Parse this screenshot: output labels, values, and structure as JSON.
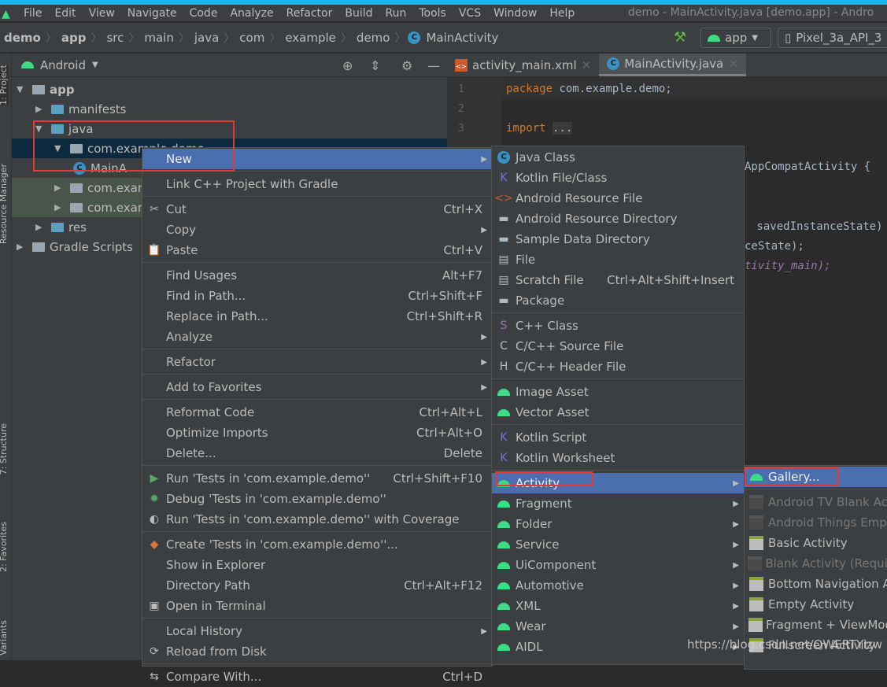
{
  "menubar": {
    "items": [
      "File",
      "Edit",
      "View",
      "Navigate",
      "Code",
      "Analyze",
      "Refactor",
      "Build",
      "Run",
      "Tools",
      "VCS",
      "Window",
      "Help"
    ],
    "window_title": "demo - MainActivity.java [demo.app] - Andro"
  },
  "breadcrumb": [
    "demo",
    "app",
    "src",
    "main",
    "java",
    "com",
    "example",
    "demo",
    "MainActivity"
  ],
  "run_config": "app",
  "device": "Pixel_3a_API_3",
  "side_tabs": [
    "1: Project",
    "Resource Manager",
    "7: Structure",
    "2: Favorites",
    "Variants"
  ],
  "project": {
    "view": "Android",
    "tree": [
      {
        "label": "app",
        "depth": 0,
        "open": true,
        "bold": true
      },
      {
        "label": "manifests",
        "depth": 1,
        "open": false
      },
      {
        "label": "java",
        "depth": 1,
        "open": true
      },
      {
        "label": "com.example.demo",
        "depth": 2,
        "open": true,
        "selected": true
      },
      {
        "label": "MainA",
        "depth": 3,
        "file": true
      },
      {
        "label": "com.exam",
        "depth": 2,
        "open": false,
        "test": true
      },
      {
        "label": "com.exam",
        "depth": 2,
        "open": false,
        "test": true
      },
      {
        "label": "res",
        "depth": 1,
        "open": false
      },
      {
        "label": "Gradle Scripts",
        "depth": 0,
        "open": false
      }
    ]
  },
  "editor": {
    "tabs": [
      "activity_main.xml",
      "MainActivity.java"
    ],
    "active_tab": 1,
    "line_numbers": [
      "1",
      "2",
      "3"
    ],
    "code": {
      "package_kw": "package",
      "package_name": " com.example.demo;",
      "import_kw": "import",
      "import_fold": "...",
      "l1": "AppCompatActivity {",
      "l2": " savedInstanceState)",
      "l3": "ceState);",
      "l4": "tivity_main);"
    }
  },
  "context_menu": [
    {
      "label": "New",
      "sel": true,
      "sub": true
    },
    "-",
    {
      "label": "Link C++ Project with Gradle"
    },
    "-",
    {
      "label": "Cut",
      "shortcut": "Ctrl+X",
      "icon": "scissors"
    },
    {
      "label": "Copy",
      "sub": true
    },
    {
      "label": "Paste",
      "shortcut": "Ctrl+V",
      "icon": "clipboard"
    },
    "-",
    {
      "label": "Find Usages",
      "shortcut": "Alt+F7"
    },
    {
      "label": "Find in Path...",
      "shortcut": "Ctrl+Shift+F"
    },
    {
      "label": "Replace in Path...",
      "shortcut": "Ctrl+Shift+R"
    },
    {
      "label": "Analyze",
      "sub": true
    },
    "-",
    {
      "label": "Refactor",
      "sub": true
    },
    "-",
    {
      "label": "Add to Favorites",
      "sub": true
    },
    "-",
    {
      "label": "Reformat Code",
      "shortcut": "Ctrl+Alt+L"
    },
    {
      "label": "Optimize Imports",
      "shortcut": "Ctrl+Alt+O"
    },
    {
      "label": "Delete...",
      "shortcut": "Delete"
    },
    "-",
    {
      "label": "Run 'Tests in 'com.example.demo''",
      "shortcut": "Ctrl+Shift+F10",
      "icon": "run"
    },
    {
      "label": "Debug 'Tests in 'com.example.demo''",
      "icon": "debug"
    },
    {
      "label": "Run 'Tests in 'com.example.demo'' with Coverage",
      "icon": "coverage"
    },
    "-",
    {
      "label": "Create 'Tests in 'com.example.demo''...",
      "icon": "create-test"
    },
    {
      "label": "Show in Explorer"
    },
    {
      "label": "Directory Path",
      "shortcut": "Ctrl+Alt+F12"
    },
    {
      "label": "Open in Terminal",
      "icon": "terminal"
    },
    "-",
    {
      "label": "Local History",
      "sub": true
    },
    {
      "label": "Reload from Disk",
      "icon": "reload"
    },
    "-",
    {
      "label": "Compare With...",
      "shortcut": "Ctrl+D",
      "icon": "compare"
    }
  ],
  "new_menu": [
    {
      "label": "Java Class",
      "icon": "java-class"
    },
    {
      "label": "Kotlin File/Class",
      "icon": "kotlin"
    },
    {
      "label": "Android Resource File",
      "icon": "xml"
    },
    {
      "label": "Android Resource Directory",
      "icon": "folder"
    },
    {
      "label": "Sample Data Directory",
      "icon": "folder"
    },
    {
      "label": "File",
      "icon": "file"
    },
    {
      "label": "Scratch File",
      "shortcut": "Ctrl+Alt+Shift+Insert",
      "icon": "scratch"
    },
    {
      "label": "Package",
      "icon": "folder"
    },
    "-",
    {
      "label": "C++ Class",
      "icon": "cpp-class"
    },
    {
      "label": "C/C++ Source File",
      "icon": "cpp-source"
    },
    {
      "label": "C/C++ Header File",
      "icon": "cpp-header"
    },
    "-",
    {
      "label": "Image Asset",
      "icon": "android"
    },
    {
      "label": "Vector Asset",
      "icon": "android"
    },
    "-",
    {
      "label": "Kotlin Script",
      "icon": "kotlin"
    },
    {
      "label": "Kotlin Worksheet",
      "icon": "kotlin"
    },
    "-",
    {
      "label": "Activity",
      "icon": "android",
      "sub": true,
      "sel": true
    },
    {
      "label": "Fragment",
      "icon": "android",
      "sub": true
    },
    {
      "label": "Folder",
      "icon": "android",
      "sub": true
    },
    {
      "label": "Service",
      "icon": "android",
      "sub": true
    },
    {
      "label": "UiComponent",
      "icon": "android",
      "sub": true
    },
    {
      "label": "Automotive",
      "icon": "android",
      "sub": true
    },
    {
      "label": "XML",
      "icon": "android",
      "sub": true
    },
    {
      "label": "Wear",
      "icon": "android",
      "sub": true
    },
    {
      "label": "AIDL",
      "icon": "android",
      "sub": true
    }
  ],
  "activity_menu": [
    {
      "label": "Gallery...",
      "icon": "android",
      "sel": true
    },
    "-",
    {
      "label": "Android TV Blank Act",
      "icon": "template",
      "dis": true
    },
    {
      "label": "Android Things Empt",
      "icon": "template",
      "dis": true
    },
    {
      "label": "Basic Activity",
      "icon": "template"
    },
    {
      "label": "Blank Activity (Requir",
      "icon": "template",
      "dis": true
    },
    {
      "label": "Bottom Navigation A",
      "icon": "template"
    },
    {
      "label": "Empty Activity",
      "icon": "template"
    },
    {
      "label": "Fragment + ViewMod",
      "icon": "template"
    },
    {
      "label": "Fullscreen Activity",
      "icon": "template"
    }
  ],
  "watermark": "https://blog.csdn.net/QWERTYizw",
  "colors": {
    "selection": "#4b6eaf",
    "highlight_box": "#e53935",
    "android": "#3ddc84",
    "accent_strip": "#17b6f0"
  }
}
